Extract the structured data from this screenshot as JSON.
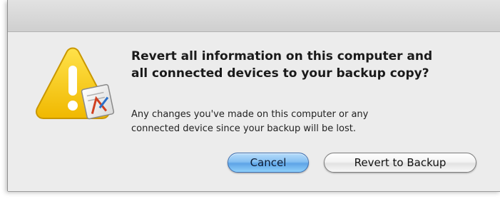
{
  "dialog": {
    "heading": "Revert all information on this computer and\nall connected devices to your backup copy?",
    "message": "Any changes you've made on this computer or any\nconnected device since your backup will be lost.",
    "icon": "warning-triangle-with-app-icon"
  },
  "buttons": {
    "cancel_label": "Cancel",
    "revert_label": "Revert to Backup"
  },
  "colors": {
    "default_button": "#6fb3ee",
    "warning_icon": "#f5c400",
    "dialog_background": "#ececec"
  }
}
